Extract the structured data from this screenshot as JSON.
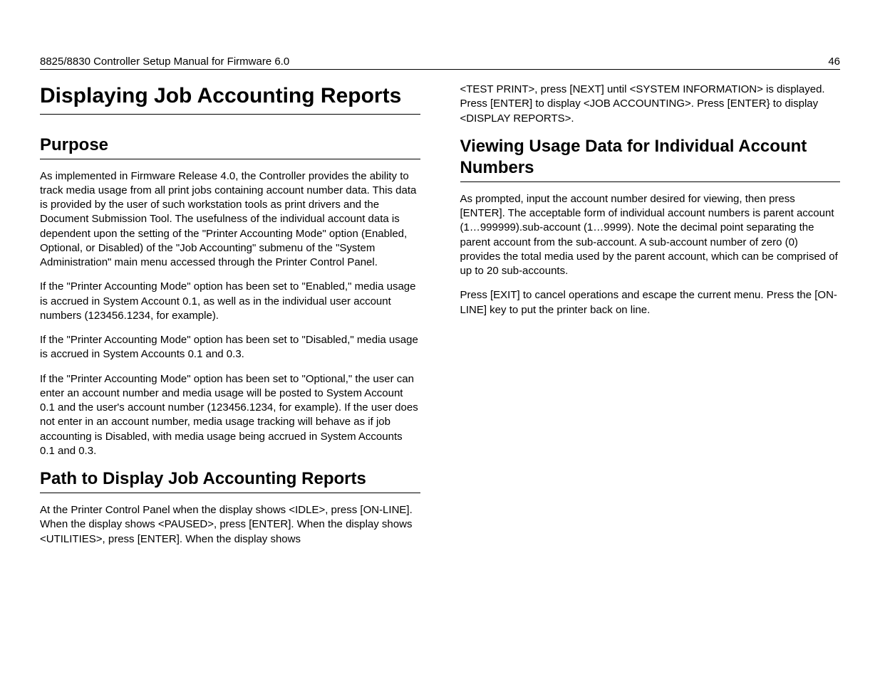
{
  "header": {
    "title": "8825/8830 Controller Setup Manual for Firmware 6.0",
    "page_number": "46"
  },
  "left": {
    "h1": "Displaying Job Accounting Reports",
    "purpose_heading": "Purpose",
    "purpose_paragraphs": [
      "As implemented in Firmware Release 4.0, the Controller provides the ability to track media usage from all print jobs containing account number data.  This data is provided by the user of such workstation tools as print drivers and the Document Submission Tool.  The usefulness of the individual account data is dependent upon the setting of the \"Printer Accounting Mode\" option (Enabled, Optional, or Disabled) of the \"Job Accounting\" submenu of the \"System Administration\" main menu accessed through the Printer Control Panel.",
      "If the \"Printer Accounting Mode\" option has been set to \"Enabled,\" media usage is accrued in System Account 0.1, as well as in the individual user account numbers (123456.1234, for example).",
      "If the \"Printer Accounting Mode\" option has been set to \"Disabled,\" media usage is accrued in System Accounts 0.1 and 0.3.",
      "If the \"Printer Accounting Mode\" option has been set to \"Optional,\" the user can enter an account number and media usage will be posted to System Account 0.1 and the user's account number (123456.1234, for example).  If the user does not enter in an account number, media usage tracking will behave as if job accounting is Disabled, with media usage being accrued in System Accounts 0.1 and 0.3."
    ],
    "path_heading": "Path to Display Job Accounting Reports",
    "path_paragraph": "At the Printer Control Panel when the display shows <IDLE>, press [ON-LINE].  When the display shows <PAUSED>, press [ENTER].  When the display shows <UTILITIES>, press [ENTER].  When the display shows"
  },
  "right": {
    "continuation_paragraph": "<TEST PRINT>, press [NEXT] until <SYSTEM INFORMATION> is displayed.  Press [ENTER] to display <JOB ACCOUNTING>.  Press [ENTER} to display <DISPLAY REPORTS>.",
    "viewing_heading": "Viewing Usage Data for Individual Account Numbers",
    "viewing_paragraphs": [
      "As prompted, input the account number desired for viewing, then press [ENTER].  The acceptable form of individual account numbers is parent account (1…999999).sub-account (1…9999).  Note the decimal point separating the parent account from the sub-account.  A sub-account number of zero (0) provides the total media used by the parent account, which can be comprised of up to 20 sub-accounts.",
      "Press [EXIT] to cancel operations and escape the current menu.  Press the [ON-LINE] key to put the printer back on line."
    ]
  }
}
